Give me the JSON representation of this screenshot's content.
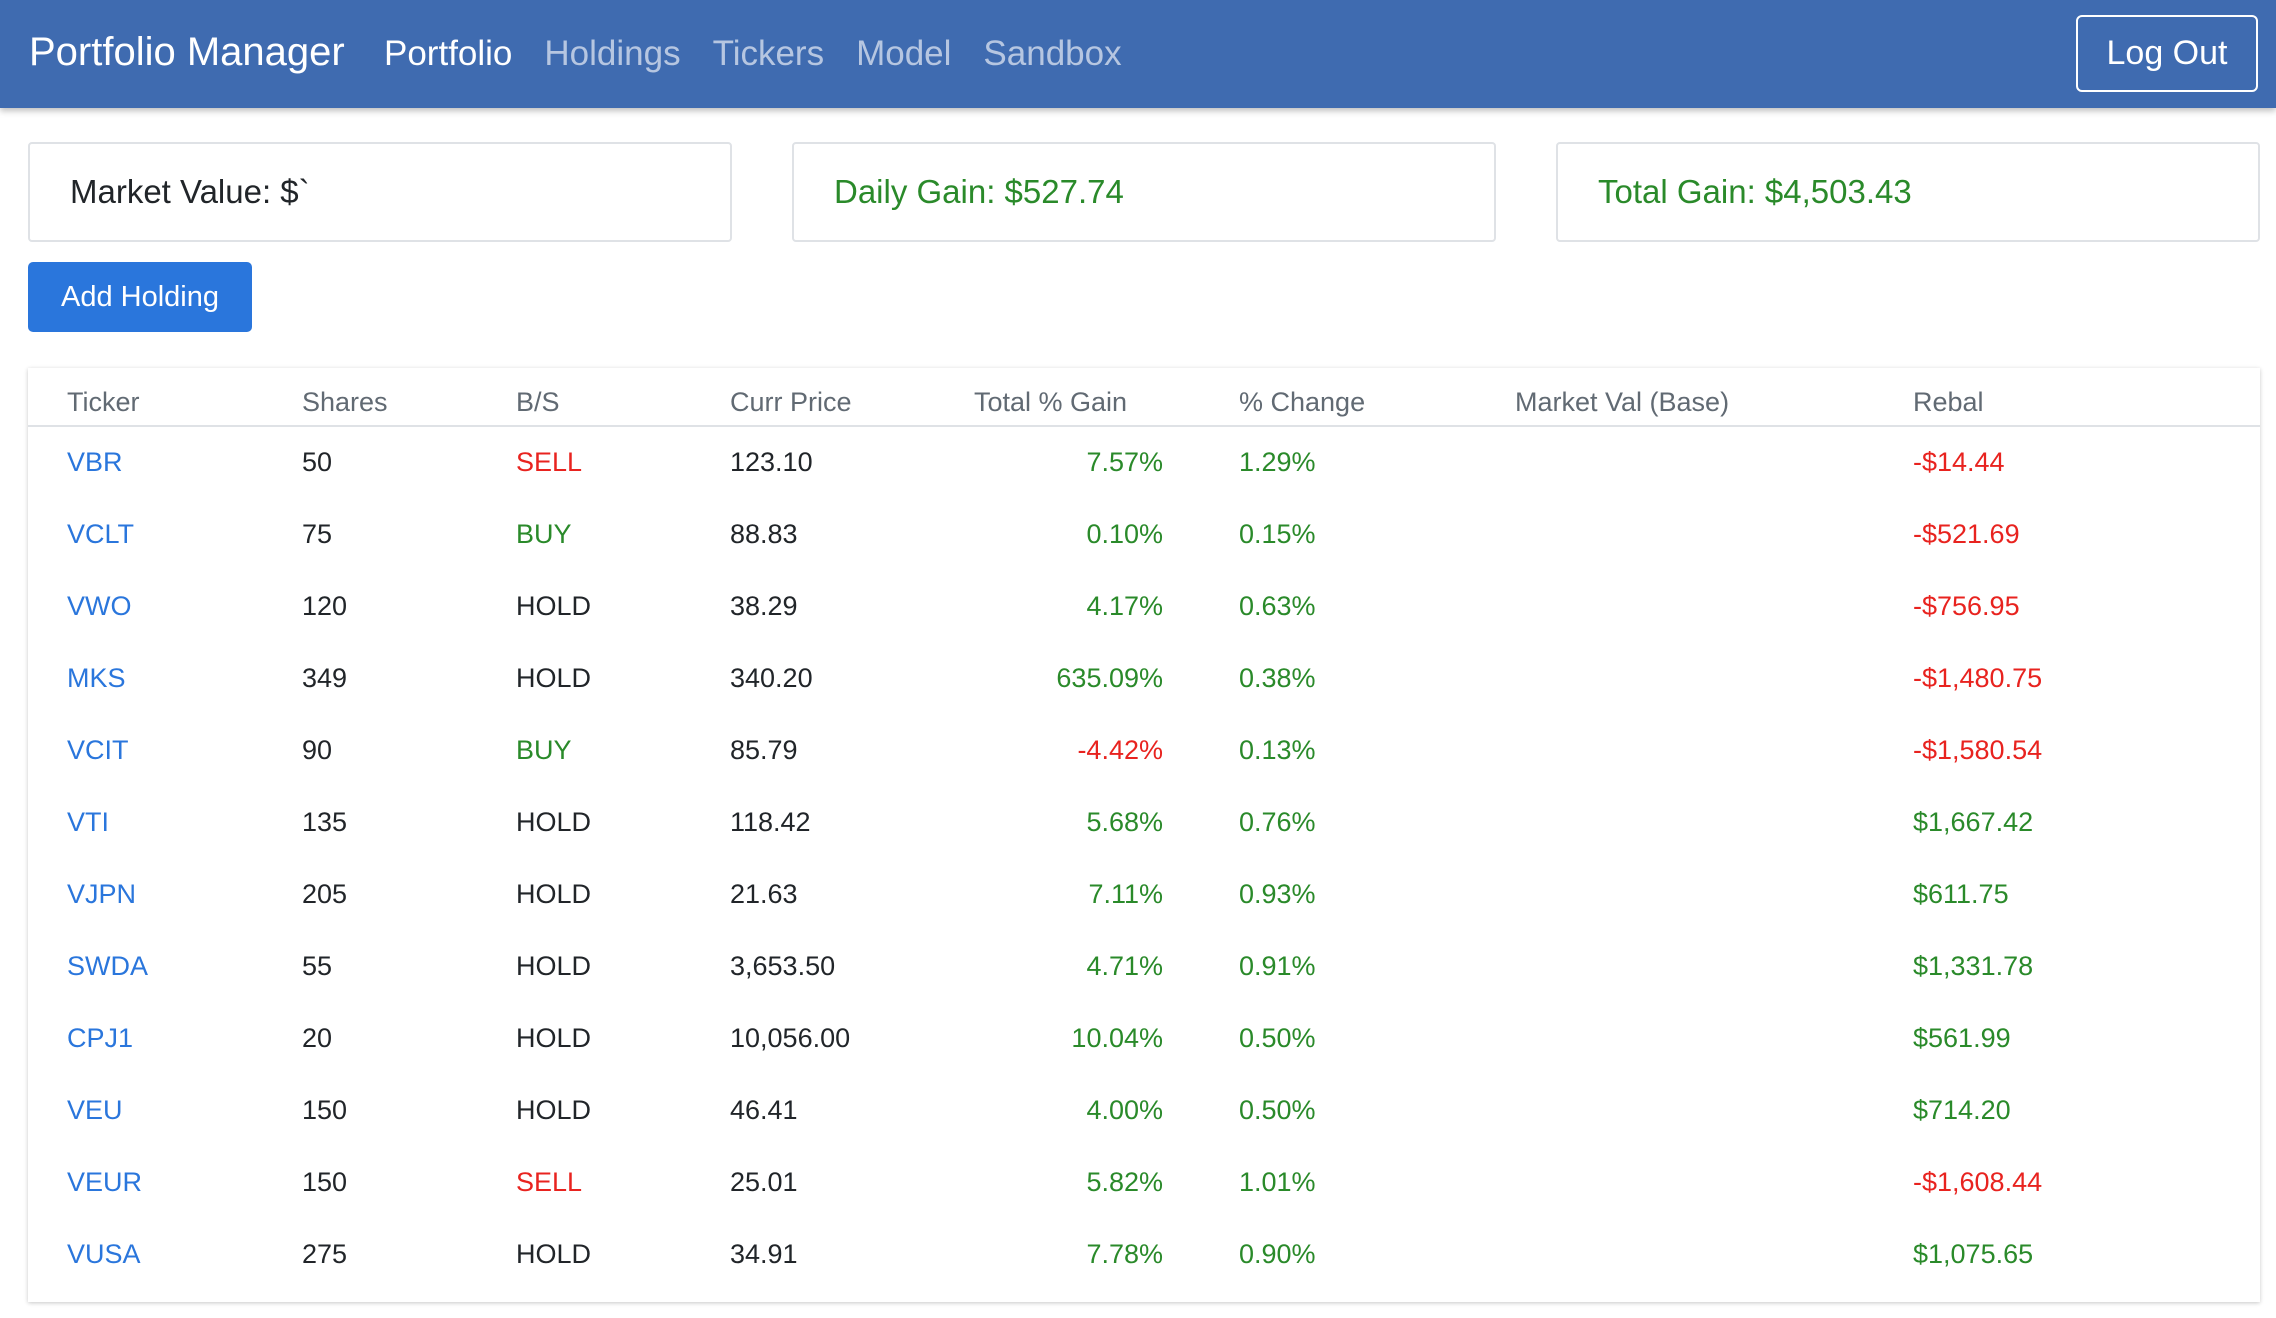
{
  "nav": {
    "brand": "Portfolio Manager",
    "links": [
      {
        "label": "Portfolio",
        "active": true
      },
      {
        "label": "Holdings",
        "active": false
      },
      {
        "label": "Tickers",
        "active": false
      },
      {
        "label": "Model",
        "active": false
      },
      {
        "label": "Sandbox",
        "active": false
      }
    ],
    "logout_label": "Log Out"
  },
  "summary": {
    "market_value": "Market Value: $`",
    "daily_gain": "Daily Gain: $527.74",
    "total_gain": "Total Gain: $4,503.43"
  },
  "actions": {
    "add_holding_label": "Add Holding"
  },
  "table": {
    "headers": {
      "ticker": "Ticker",
      "shares": "Shares",
      "bs": "B/S",
      "price": "Curr Price",
      "gain": "Total % Gain",
      "change": "% Change",
      "market_val": "Market Val (Base)",
      "rebal": "Rebal"
    },
    "rows": [
      {
        "ticker": "VBR",
        "shares": "50",
        "bs": "SELL",
        "price": "123.10",
        "gain": "7.57%",
        "change": "1.29%",
        "market_val": "",
        "rebal": "-$14.44"
      },
      {
        "ticker": "VCLT",
        "shares": "75",
        "bs": "BUY",
        "price": "88.83",
        "gain": "0.10%",
        "change": "0.15%",
        "market_val": "",
        "rebal": "-$521.69"
      },
      {
        "ticker": "VWO",
        "shares": "120",
        "bs": "HOLD",
        "price": "38.29",
        "gain": "4.17%",
        "change": "0.63%",
        "market_val": "",
        "rebal": "-$756.95"
      },
      {
        "ticker": "MKS",
        "shares": "349",
        "bs": "HOLD",
        "price": "340.20",
        "gain": "635.09%",
        "change": "0.38%",
        "market_val": "",
        "rebal": "-$1,480.75"
      },
      {
        "ticker": "VCIT",
        "shares": "90",
        "bs": "BUY",
        "price": "85.79",
        "gain": "-4.42%",
        "change": "0.13%",
        "market_val": "",
        "rebal": "-$1,580.54"
      },
      {
        "ticker": "VTI",
        "shares": "135",
        "bs": "HOLD",
        "price": "118.42",
        "gain": "5.68%",
        "change": "0.76%",
        "market_val": "",
        "rebal": "$1,667.42"
      },
      {
        "ticker": "VJPN",
        "shares": "205",
        "bs": "HOLD",
        "price": "21.63",
        "gain": "7.11%",
        "change": "0.93%",
        "market_val": "",
        "rebal": "$611.75"
      },
      {
        "ticker": "SWDA",
        "shares": "55",
        "bs": "HOLD",
        "price": "3,653.50",
        "gain": "4.71%",
        "change": "0.91%",
        "market_val": "",
        "rebal": "$1,331.78"
      },
      {
        "ticker": "CPJ1",
        "shares": "20",
        "bs": "HOLD",
        "price": "10,056.00",
        "gain": "10.04%",
        "change": "0.50%",
        "market_val": "",
        "rebal": "$561.99"
      },
      {
        "ticker": "VEU",
        "shares": "150",
        "bs": "HOLD",
        "price": "46.41",
        "gain": "4.00%",
        "change": "0.50%",
        "market_val": "",
        "rebal": "$714.20"
      },
      {
        "ticker": "VEUR",
        "shares": "150",
        "bs": "SELL",
        "price": "25.01",
        "gain": "5.82%",
        "change": "1.01%",
        "market_val": "",
        "rebal": "-$1,608.44"
      },
      {
        "ticker": "VUSA",
        "shares": "275",
        "bs": "HOLD",
        "price": "34.91",
        "gain": "7.78%",
        "change": "0.90%",
        "market_val": "",
        "rebal": "$1,075.65"
      }
    ]
  },
  "colors": {
    "navbar": "#3f6bb0",
    "primary": "#2a76dc",
    "positive": "#2a8a2a",
    "negative": "#e8231f"
  }
}
